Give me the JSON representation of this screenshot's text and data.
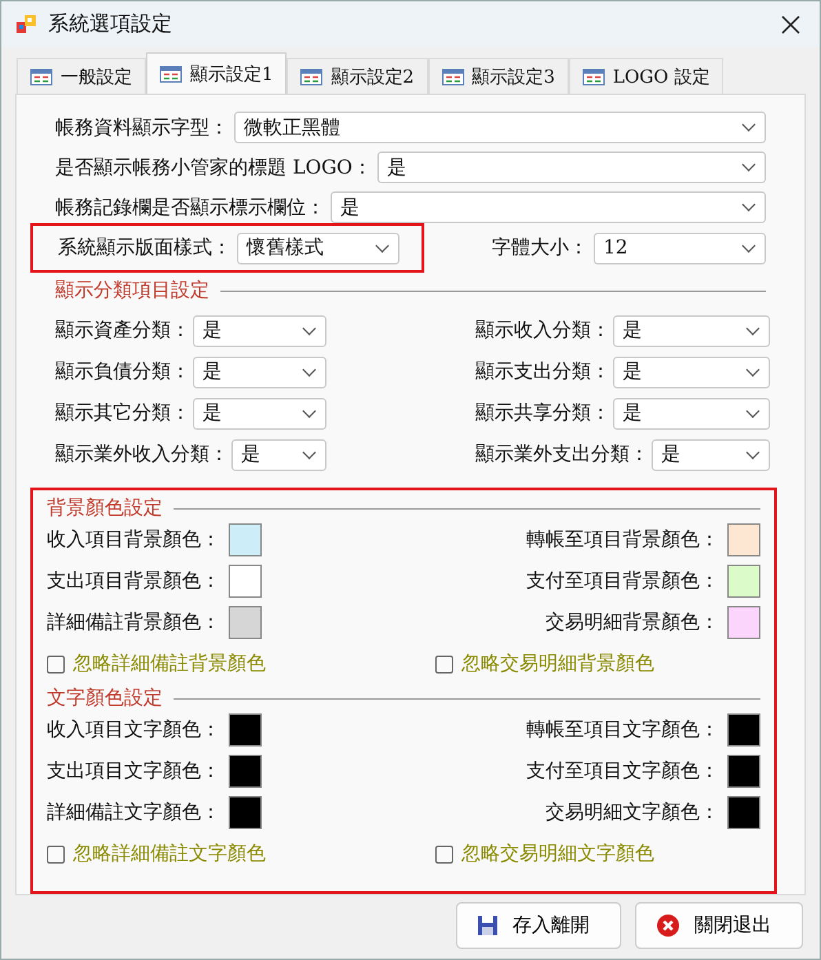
{
  "window": {
    "title": "系統選項設定"
  },
  "tabs": [
    {
      "label": "一般設定",
      "selected": false
    },
    {
      "label": "顯示設定1",
      "selected": true
    },
    {
      "label": "顯示設定2",
      "selected": false
    },
    {
      "label": "顯示設定3",
      "selected": false
    },
    {
      "label": "LOGO 設定",
      "selected": false
    }
  ],
  "general": [
    {
      "label": "帳務資料顯示字型：",
      "value": "微軟正黑體"
    },
    {
      "label": "是否顯示帳務小管家的標題 LOGO：",
      "value": "是"
    },
    {
      "label": "帳務記錄欄是否顯示標示欄位：",
      "value": "是"
    }
  ],
  "style_row": {
    "label": "系統顯示版面樣式：",
    "value": "懷舊樣式",
    "highlighted": true
  },
  "font_size": {
    "label": "字體大小：",
    "value": "12"
  },
  "category_section": {
    "title": "顯示分類項目設定",
    "items": [
      {
        "label": "顯示資產分類：",
        "value": "是"
      },
      {
        "label": "顯示收入分類：",
        "value": "是"
      },
      {
        "label": "顯示負債分類：",
        "value": "是"
      },
      {
        "label": "顯示支出分類：",
        "value": "是"
      },
      {
        "label": "顯示其它分類：",
        "value": "是"
      },
      {
        "label": "顯示共享分類：",
        "value": "是"
      },
      {
        "label": "顯示業外收入分類：",
        "value": "是"
      },
      {
        "label": "顯示業外支出分類：",
        "value": "是"
      }
    ]
  },
  "colors": {
    "highlighted": true,
    "sections": [
      {
        "title": "背景顏色設定",
        "items": [
          {
            "label": "收入項目背景顏色：",
            "color": "#cdeef8"
          },
          {
            "label": "轉帳至項目背景顏色：",
            "color": "#fde6d2"
          },
          {
            "label": "支出項目背景顏色：",
            "color": "#ffffff"
          },
          {
            "label": "支付至項目背景顏色：",
            "color": "#dbfbc8"
          },
          {
            "label": "詳細備註背景顏色：",
            "color": "#d6d6d6"
          },
          {
            "label": "交易明細背景顏色：",
            "color": "#fbd5fb"
          }
        ],
        "ignore": [
          {
            "label": "忽略詳細備註背景顏色",
            "checked": false
          },
          {
            "label": "忽略交易明細背景顏色",
            "checked": false
          }
        ]
      },
      {
        "title": "文字顏色設定",
        "items": [
          {
            "label": "收入項目文字顏色：",
            "color": "#000000"
          },
          {
            "label": "轉帳至項目文字顏色：",
            "color": "#000000"
          },
          {
            "label": "支出項目文字顏色：",
            "color": "#000000"
          },
          {
            "label": "支付至項目文字顏色：",
            "color": "#000000"
          },
          {
            "label": "詳細備註文字顏色：",
            "color": "#000000"
          },
          {
            "label": "交易明細文字顏色：",
            "color": "#000000"
          }
        ],
        "ignore": [
          {
            "label": "忽略詳細備註文字顏色",
            "checked": false
          },
          {
            "label": "忽略交易明細文字顏色",
            "checked": false
          }
        ]
      }
    ]
  },
  "buttons": [
    {
      "label": "存入離開",
      "kind": "save"
    },
    {
      "label": "關閉退出",
      "kind": "close"
    }
  ]
}
